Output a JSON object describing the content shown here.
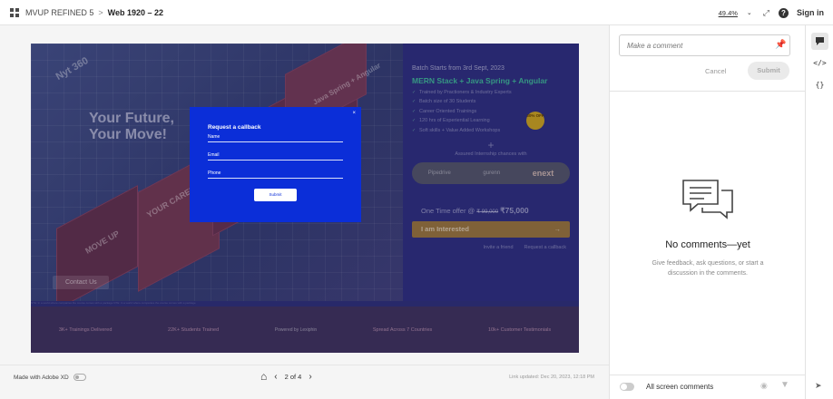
{
  "topbar": {
    "project": "MVUP REFINED 5",
    "separator": ">",
    "artboard": "Web 1920 – 22",
    "zoom": "49.4%",
    "sign_in": "Sign in"
  },
  "artboard": {
    "watermark_1": "Nyt 360",
    "tagline_line1": "Your Future,",
    "tagline_line2": "Your Move!",
    "pan_text_1": "MOVE UP",
    "pan_text_2": "YOUR CAREER",
    "pan_text_3": "Java Spring + Angular",
    "contact_us": "Contact Us",
    "batch": "Batch Starts from 3rd Sept, 2023",
    "stack": "MERN Stack + Java Spring + Angular",
    "bullets": [
      "Trained by Practioners & Industry Experts",
      "Batch size of 30 Students",
      "Career Oriented Trainings",
      "120 hrs of Experiential Learning",
      "Soft skills + Value Added Workshops"
    ],
    "badge": "30% OFF",
    "plus": "+",
    "assured": "Assured Internship chances with",
    "logos": [
      "Pipedrive",
      "gurenn",
      "enext"
    ],
    "offer_label": "One Time offer @",
    "offer_old": "₹ 99,000",
    "offer_price": "₹75,000",
    "interested": "I am Interested",
    "invite": "Invite a friend",
    "request": "Request a callback",
    "strip_text": "NTE: In a world where companies the course comes with a package NTE: In a world where companies the course comes with a package",
    "footer_items": [
      "3K+ Trainings Delivered",
      "22K+ Students Trained",
      "Powered by Lexiphin",
      "Spread Across 7 Countries",
      "10k+ Customer Testimonials"
    ]
  },
  "modal": {
    "close": "×",
    "title": "Request a callback",
    "fields": [
      "Name",
      "Email",
      "Phone"
    ],
    "submit": "Submit"
  },
  "bottombar": {
    "made_with": "Made with Adobe XD",
    "page": "2 of 4",
    "updated": "Link updated: Dec 20, 2023, 12:18 PM"
  },
  "comments": {
    "placeholder": "Make a comment",
    "cancel": "Cancel",
    "submit": "Submit",
    "empty_title": "No comments—yet",
    "empty_text": "Give feedback, ask questions, or start a discussion in the comments.",
    "all_screen": "All screen comments"
  },
  "rail": {
    "code_icon": "</>",
    "braces_icon": "{}"
  }
}
